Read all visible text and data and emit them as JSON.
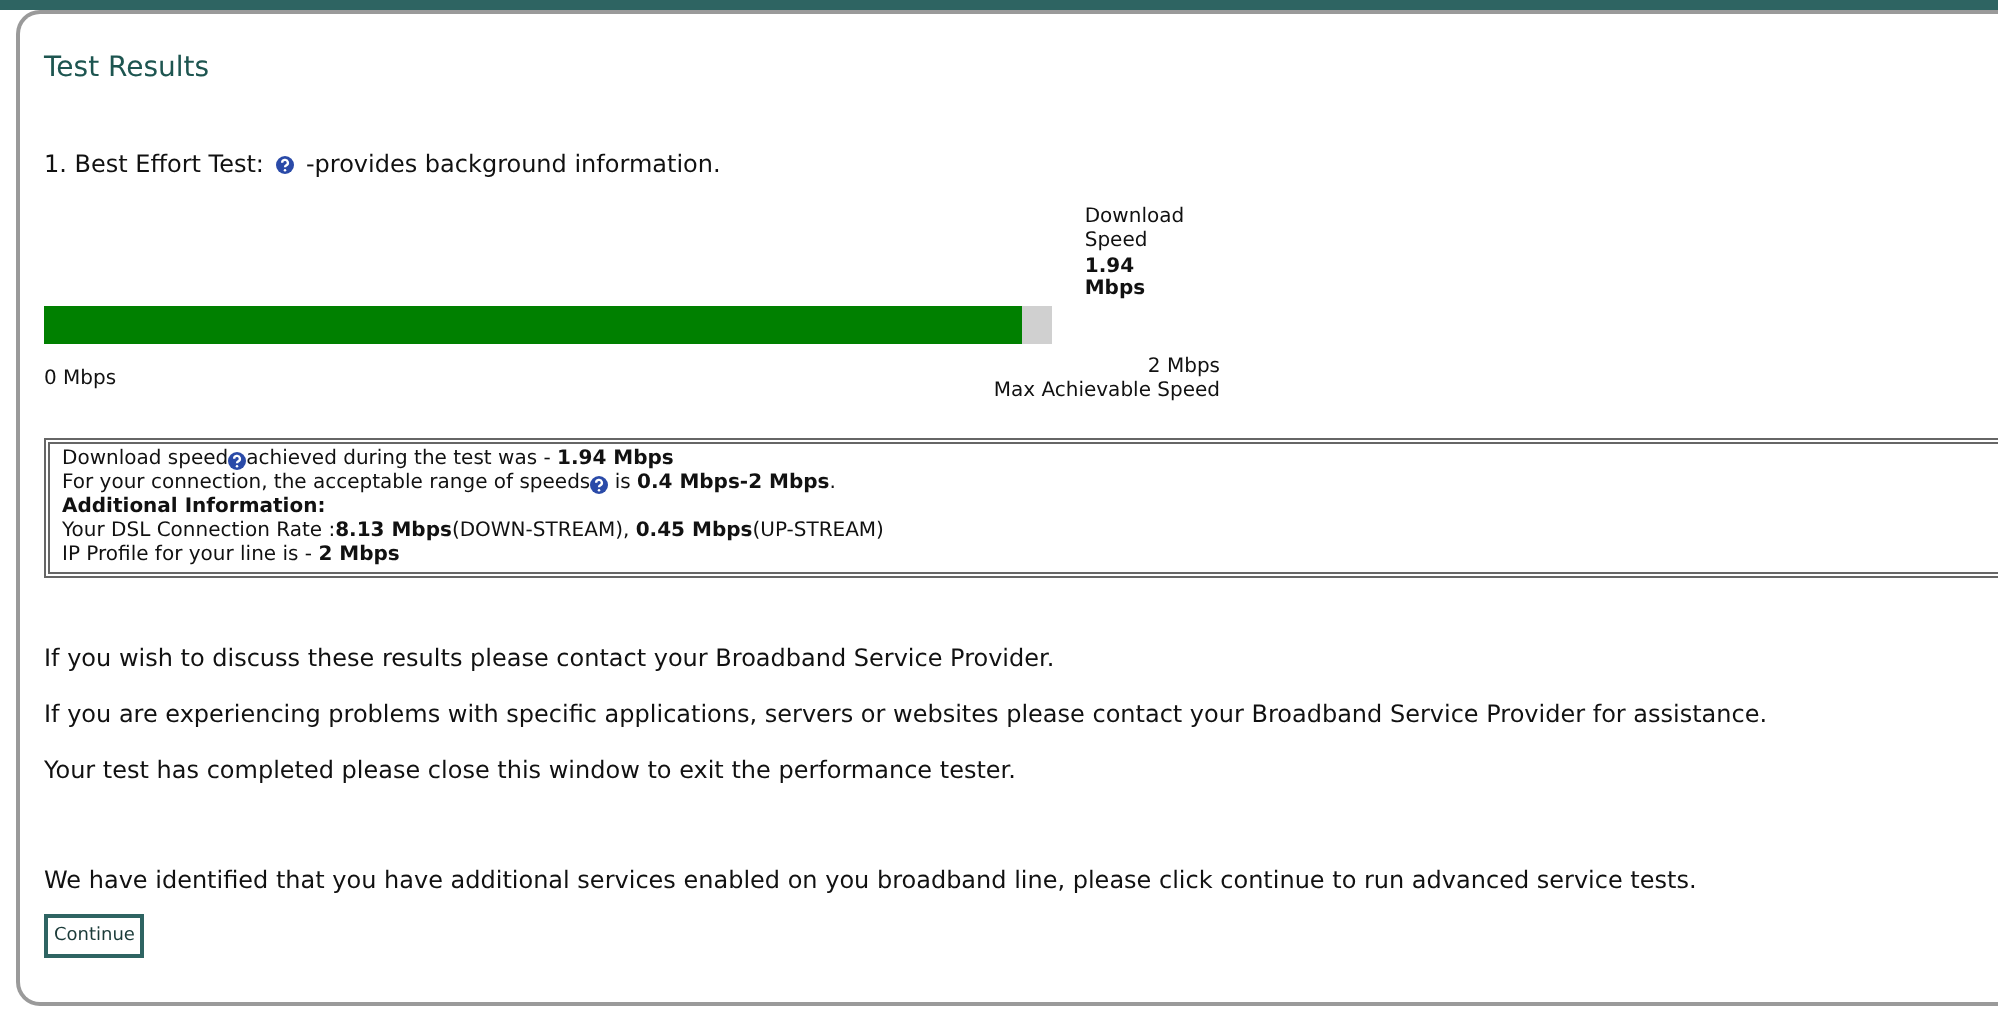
{
  "title": "Test Results",
  "test_heading": {
    "before": "1. Best Effort Test:",
    "after": "-provides background information."
  },
  "meter": {
    "label": "Download\nSpeed",
    "value": "1.94 Mbps",
    "level": 0.97,
    "min_label": "0 Mbps",
    "max_label": "2 Mbps",
    "max_caption": "Max Achievable Speed"
  },
  "info_lines": [
    {
      "parts": [
        {
          "kind": "text",
          "text": "Download speed"
        },
        {
          "kind": "help"
        },
        {
          "kind": "text",
          "text": "achieved during the test was - **1.94 Mbps**"
        }
      ]
    },
    {
      "parts": [
        {
          "kind": "text",
          "text": "For your connection, the acceptable range of speeds"
        },
        {
          "kind": "help"
        },
        {
          "kind": "text",
          "text": " is **0.4 Mbps-2 Mbps**."
        }
      ]
    },
    {
      "parts": [
        {
          "kind": "text",
          "text": "**Additional Information:**"
        }
      ]
    },
    {
      "parts": [
        {
          "kind": "text",
          "text": "Your DSL Connection Rate :**8.13 Mbps**(DOWN-STREAM), **0.45 Mbps**(UP-STREAM)"
        }
      ]
    },
    {
      "parts": [
        {
          "kind": "text",
          "text": "IP Profile for your line is - **2 Mbps**"
        }
      ]
    }
  ],
  "messages": [
    "If you wish to discuss these results please contact your Broadband Service Provider.",
    "If you are experiencing problems with specific applications, servers or websites please contact your Broadband Service Provider for assistance.",
    "Your test has completed please close this window to exit the performance tester."
  ],
  "notice": "We have identified that you have additional services enabled on you broadband line, please click continue to run advanced service tests.",
  "button": "Continue"
}
